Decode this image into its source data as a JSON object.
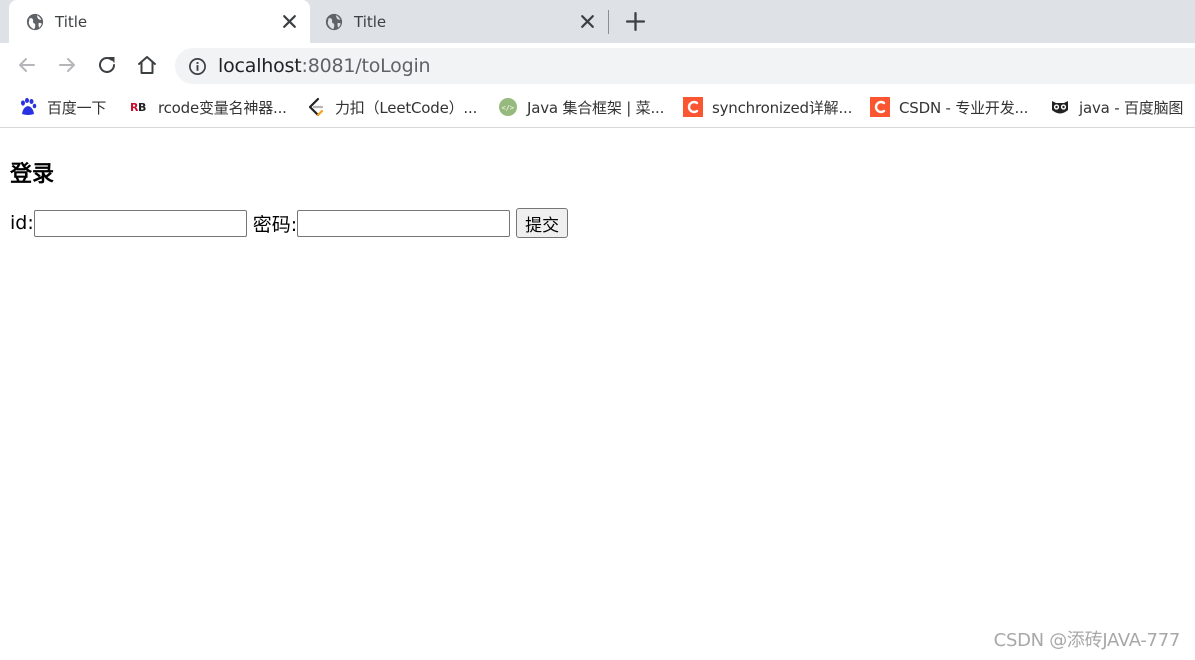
{
  "tabs": [
    {
      "title": "Title",
      "active": true
    },
    {
      "title": "Title",
      "active": false
    }
  ],
  "toolbar": {
    "url_host": "localhost",
    "url_rest": ":8081/toLogin"
  },
  "bookmarks": [
    {
      "label": "百度一下",
      "icon": "baidu-paw-icon"
    },
    {
      "label": "rcode变量名神器...",
      "icon": "rb-logo-icon"
    },
    {
      "label": "力扣（LeetCode）...",
      "icon": "leetcode-icon"
    },
    {
      "label": "Java 集合框架 | 菜...",
      "icon": "runoob-icon"
    },
    {
      "label": "synchronized详解...",
      "icon": "csdn-c-icon"
    },
    {
      "label": "CSDN - 专业开发...",
      "icon": "csdn-c-icon"
    },
    {
      "label": "java - 百度脑图",
      "icon": "naotu-owl-icon"
    }
  ],
  "page": {
    "heading": "登录",
    "id_label": "id:",
    "id_value": "",
    "password_label": "密码:",
    "password_value": "",
    "submit_label": "提交"
  },
  "watermark": "CSDN @添砖JAVA-777",
  "colors": {
    "tabstrip": "#dee1e6",
    "omnibox": "#f1f3f4",
    "csdn_red": "#fc5531",
    "baidu_blue": "#2932e1"
  }
}
